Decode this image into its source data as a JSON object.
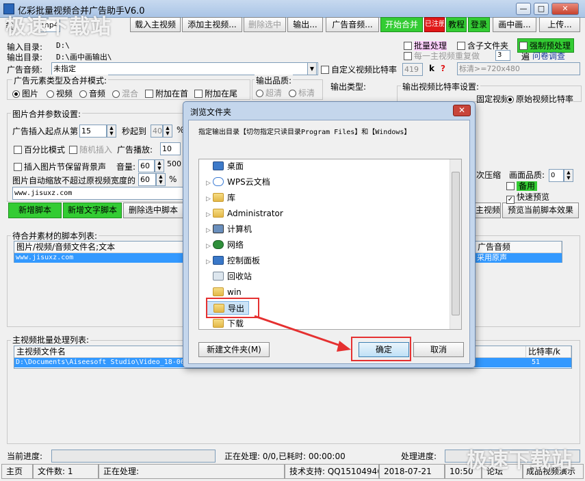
{
  "window": {
    "title": "亿彩批量视频合并广告助手V6.0",
    "minimize": "—",
    "maximize": "□",
    "close": "✕"
  },
  "toolbar": {
    "type_label": "类",
    "format_value": "mp4",
    "load_main_video": "载入主视频",
    "add_main_video": "添加主视频...",
    "delete_selected": "删除选中",
    "output": "输出...",
    "ad_audio": "广告音频...",
    "start_merge": "开始合并",
    "registered": "已注册",
    "tutorial": "教程",
    "login": "登录",
    "pip": "画中画...",
    "upload": "上传..."
  },
  "paths": {
    "input_label": "输入目录:",
    "input_value": "D:\\",
    "output_label": "输出目录:",
    "output_value": "D:\\画中画输出\\",
    "ad_audio_label": "广告音频:",
    "ad_audio_value": "未指定"
  },
  "options": {
    "batch_process": "批量处理",
    "include_subfolder": "含子文件夹",
    "force_preprocess": "强制预处理",
    "repeat_each": "每一主视频重复做",
    "repeat_count": "3",
    "repeat_unit": "遍",
    "survey": "问卷调查",
    "custom_bitrate": "自定义视频比特率",
    "bitrate_value": "419",
    "bitrate_unit": "k",
    "help_mark": "?",
    "quality_value": "标清>=720x480"
  },
  "ad_elements": {
    "title": "广告元素类型及合并模式:",
    "picture": "图片",
    "video": "视频",
    "audio": "音频",
    "mix": "混合",
    "append_head": "附加在首",
    "append_tail": "附加在尾"
  },
  "output_quality": {
    "title": "输出品质:",
    "super": "超清",
    "standard": "标清"
  },
  "output_type": {
    "title": "输出类型:"
  },
  "bitrate_setting": {
    "title": "输出视频比特率设置:",
    "fixed": "固定视频比特率1830k",
    "original": "原始视频比特率"
  },
  "pic_params": {
    "title": "图片合并参数设置:",
    "insert_start": "广告插入起点从第",
    "insert_start_value": "15",
    "sec_to": "秒起到",
    "sec_to_value": "40",
    "percent_sign": "%",
    "percent_mode": "百分比模式",
    "random_insert": "随机插入",
    "ad_play": "广告播放:",
    "ad_play_value": "10",
    "keep_bg_sound": "插入图片节保留背景声",
    "volume": "音量:",
    "volume_value": "60",
    "volume_max": "500",
    "auto_scale": "图片自动缩放不超过原视频宽度的",
    "auto_scale_value": "60",
    "auto_scale_unit": "%",
    "text_value": "www.jisuxz.com"
  },
  "script_buttons": {
    "new_script": "新增脚本",
    "new_text_script": "新增文字脚本",
    "delete_script": "删除选中脚本",
    "main_video": "主视频",
    "preview_effect": "预览当前脚本效果"
  },
  "right_options": {
    "second_compress": "次压缩",
    "frame_quality": "画面品质:",
    "frame_quality_value": "0",
    "spare": "备用",
    "fast_preview": "快速预览"
  },
  "script_list": {
    "title": "待合并素材的脚本列表:",
    "col_files": "图片/视频/音频文件名;文本",
    "col_ad_audio": "广告音频",
    "row_text": "www.jisuxz.com",
    "row_audio": "采用原声"
  },
  "main_list": {
    "title": "主视频批量处理列表:",
    "col_name": "主视频文件名",
    "col_bitrate": "比特率/k",
    "row_name": "D:\\Documents\\Aiseesoft Studio\\Video_18-06",
    "row_bitrate": "51"
  },
  "progress": {
    "current": "当前进度:",
    "processing": "正在处理: 0/0,已耗时: 00:00:00",
    "process_progress": "处理进度:"
  },
  "statusbar": {
    "home": "主页",
    "file_count": "文件数: 1",
    "processing": "正在处理:",
    "support": "技术支持: QQ15104946",
    "date": "2018-07-21",
    "time": "10:50",
    "forum": "论坛",
    "demo": "成品视频演示"
  },
  "watermark": {
    "text": "极速下载站"
  },
  "dialog": {
    "title": "浏览文件夹",
    "close": "✕",
    "instruction": "指定输出目录【切勿指定只读目录Program Files】和【Windows】",
    "tree": [
      {
        "label": "桌面",
        "icon": "desktop-icon"
      },
      {
        "label": "WPS云文档",
        "icon": "cloud-icon"
      },
      {
        "label": "库",
        "icon": "library-icon"
      },
      {
        "label": "Administrator",
        "icon": "user-folder-icon"
      },
      {
        "label": "计算机",
        "icon": "computer-icon"
      },
      {
        "label": "网络",
        "icon": "network-icon"
      },
      {
        "label": "控制面板",
        "icon": "control-panel-icon"
      },
      {
        "label": "回收站",
        "icon": "recycle-bin-icon"
      },
      {
        "label": "win",
        "icon": "folder-icon"
      },
      {
        "label": "导出",
        "icon": "folder-icon"
      },
      {
        "label": "下载",
        "icon": "folder-icon"
      }
    ],
    "new_folder": "新建文件夹(M)",
    "ok": "确定",
    "cancel": "取消"
  },
  "colors": {
    "accent_red": "#e53030",
    "green": "#33cc33",
    "select_blue": "#3399ff"
  }
}
